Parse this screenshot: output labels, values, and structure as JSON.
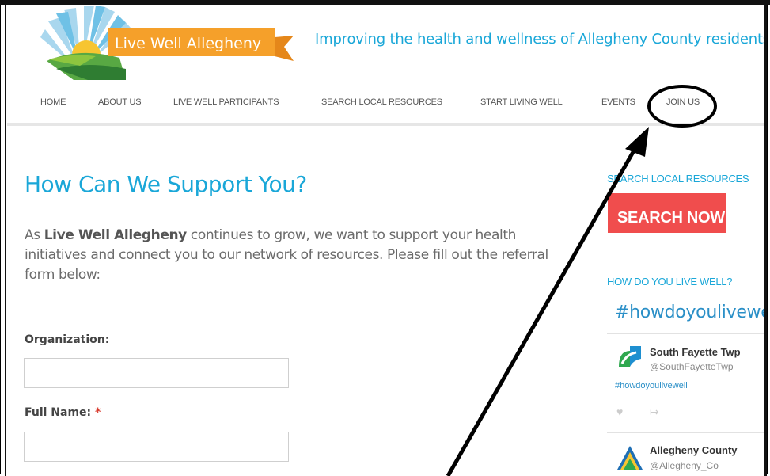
{
  "header": {
    "logo_text": "Live Well Allegheny",
    "tagline": "Improving the health and wellness of Allegheny County residents"
  },
  "nav": {
    "items": [
      {
        "label": "HOME"
      },
      {
        "label": "ABOUT US"
      },
      {
        "label": "LIVE WELL PARTICIPANTS"
      },
      {
        "label": "SEARCH LOCAL RESOURCES"
      },
      {
        "label": "START LIVING WELL"
      },
      {
        "label": "EVENTS"
      },
      {
        "label": "JOIN US"
      }
    ]
  },
  "main": {
    "title": "How Can We Support You?",
    "intro_prefix": "As ",
    "intro_bold": "Live Well Allegheny",
    "intro_suffix": " continues to grow, we want to support your health initiatives and connect you to our network of resources. Please fill out the referral form below:",
    "form": {
      "organization_label": "Organization:",
      "organization_value": "",
      "full_name_label": "Full Name:",
      "full_name_required": "*",
      "full_name_value": ""
    }
  },
  "sidebar": {
    "search_heading": "SEARCH LOCAL RESOURCES",
    "search_button": "SEARCH NOW",
    "live_well_heading": "HOW DO YOU LIVE WELL?",
    "hashtag_title": "#howdoyoulivewell",
    "tweets": [
      {
        "name": "South Fayette Twp",
        "handle": "@SouthFayetteTwp",
        "text": "#howdoyoulivewell"
      },
      {
        "name": "Allegheny County",
        "handle": "@Allegheny_Co"
      }
    ]
  },
  "colors": {
    "accent": "#1aa7d8",
    "button_red": "#f04d4d",
    "logo_orange": "#f5a02a",
    "annotation": "#000000"
  },
  "icons": [
    "heart-icon",
    "share-icon",
    "sun-logo-icon"
  ]
}
